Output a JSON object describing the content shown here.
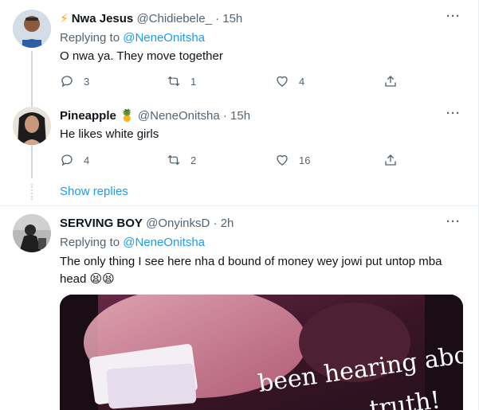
{
  "tweets": [
    {
      "badge": "⚡",
      "name": "Nwa Jesus",
      "handle": "@Chidiebele_",
      "dot": "·",
      "time": "15h",
      "replying_label": "Replying to",
      "replying_to": "@NeneOnitsha",
      "text": "O nwa ya. They move together",
      "replies": "3",
      "retweets": "1",
      "likes": "4",
      "more": "···"
    },
    {
      "name": "Pineapple",
      "badge": "🍍",
      "handle": "@NeneOnitsha",
      "dot": "·",
      "time": "15h",
      "text": "He likes white girls",
      "replies": "4",
      "retweets": "2",
      "likes": "16",
      "more": "···"
    },
    {
      "name": "SERVING BOY",
      "handle": "@OnyinksD",
      "dot": "·",
      "time": "2h",
      "replying_label": "Replying to",
      "replying_to": "@NeneOnitsha",
      "text": "The only thing I see here nha d bound of money wey jowi put untop mba head 😫😫",
      "more": "···",
      "media_caption_lines": [
        "been hearing about",
        "truth!"
      ]
    }
  ],
  "show_replies": "Show replies",
  "icons": {
    "reply": "reply-icon",
    "retweet": "retweet-icon",
    "like": "heart-icon",
    "share": "share-icon",
    "more": "more-icon"
  },
  "colors": {
    "accent": "#1d9bf0",
    "secondary_text": "#536471",
    "primary_text": "#0f1419",
    "divider": "#ebeef0"
  }
}
